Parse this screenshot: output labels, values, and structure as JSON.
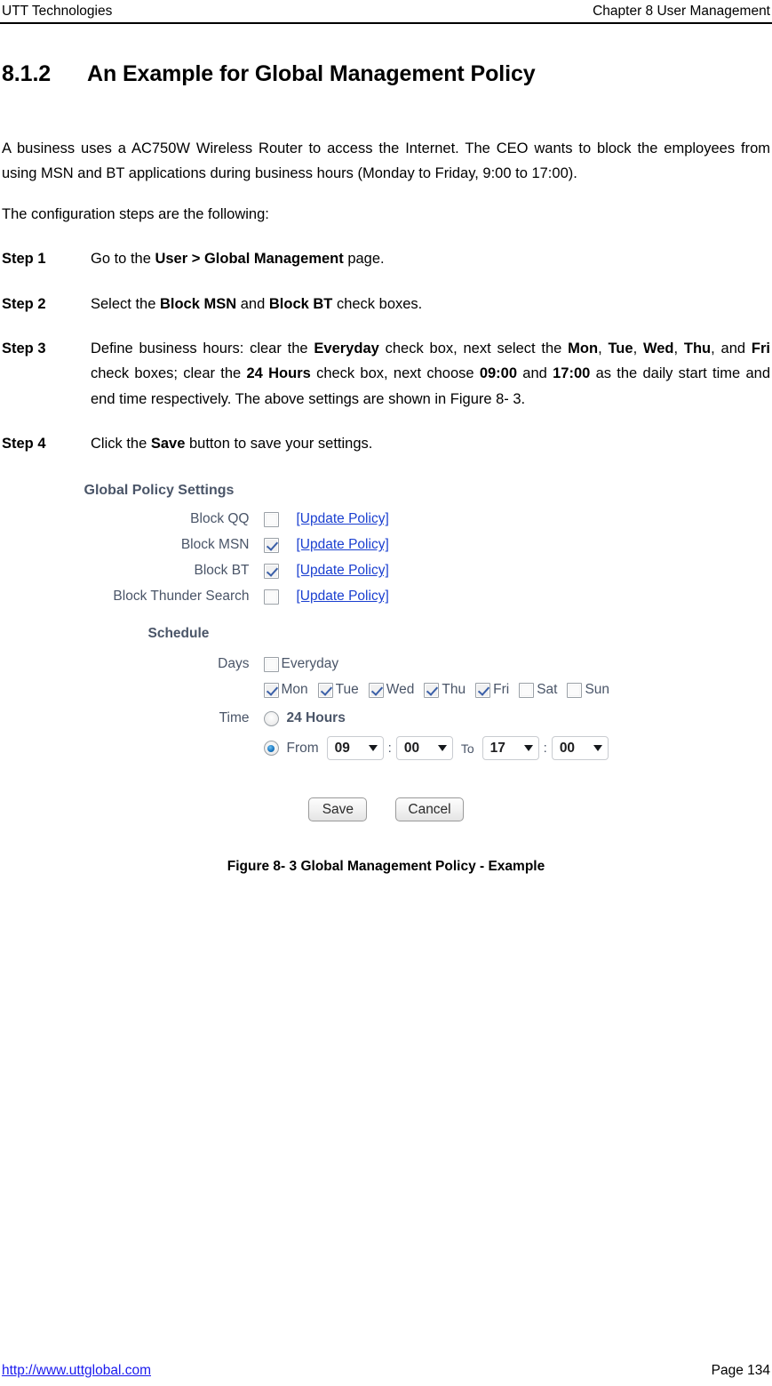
{
  "header": {
    "left": "UTT Technologies",
    "right": "Chapter 8 User Management"
  },
  "section": {
    "number": "8.1.2",
    "title": "An Example for Global Management Policy"
  },
  "intro": {
    "paragraph": "A business uses a AC750W Wireless Router to access the Internet. The CEO wants to block the employees from using MSN and BT applications during business hours (Monday to Friday, 9:00 to 17:00).",
    "steps_lead": "The configuration steps are the following:"
  },
  "steps": [
    {
      "label": "Step 1",
      "parts": [
        {
          "text": "Go to the ",
          "bold": false
        },
        {
          "text": "User > Global Management",
          "bold": true
        },
        {
          "text": " page.",
          "bold": false
        }
      ]
    },
    {
      "label": "Step 2",
      "parts": [
        {
          "text": "Select the ",
          "bold": false
        },
        {
          "text": "Block MSN",
          "bold": true
        },
        {
          "text": " and ",
          "bold": false
        },
        {
          "text": "Block BT",
          "bold": true
        },
        {
          "text": " check boxes.",
          "bold": false
        }
      ]
    },
    {
      "label": "Step 3",
      "parts": [
        {
          "text": "Define business hours: clear the ",
          "bold": false
        },
        {
          "text": "Everyday",
          "bold": true
        },
        {
          "text": " check box, next select the ",
          "bold": false
        },
        {
          "text": "Mon",
          "bold": true
        },
        {
          "text": ", ",
          "bold": false
        },
        {
          "text": "Tue",
          "bold": true
        },
        {
          "text": ", ",
          "bold": false
        },
        {
          "text": "Wed",
          "bold": true
        },
        {
          "text": ", ",
          "bold": false
        },
        {
          "text": "Thu",
          "bold": true
        },
        {
          "text": ", and ",
          "bold": false
        },
        {
          "text": "Fri",
          "bold": true
        },
        {
          "text": " check boxes; clear the ",
          "bold": false
        },
        {
          "text": "24 Hours",
          "bold": true
        },
        {
          "text": " check box, next choose ",
          "bold": false
        },
        {
          "text": "09:00",
          "bold": true
        },
        {
          "text": " and ",
          "bold": false
        },
        {
          "text": "17:00",
          "bold": true
        },
        {
          "text": " as the daily start time and end time respectively. The above settings are shown in Figure 8- 3.",
          "bold": false
        }
      ]
    },
    {
      "label": "Step 4",
      "parts": [
        {
          "text": "Click the ",
          "bold": false
        },
        {
          "text": "Save",
          "bold": true
        },
        {
          "text": " button to save your settings.",
          "bold": false
        }
      ]
    }
  ],
  "router_ui": {
    "global_policy_title": "Global Policy Settings",
    "policies": [
      {
        "label": "Block QQ",
        "checked": false,
        "link": "[Update Policy]"
      },
      {
        "label": "Block MSN",
        "checked": true,
        "link": "[Update Policy]"
      },
      {
        "label": "Block BT",
        "checked": true,
        "link": "[Update Policy]"
      },
      {
        "label": "Block Thunder Search",
        "checked": false,
        "link": "[Update Policy]"
      }
    ],
    "schedule_title": "Schedule",
    "days_label": "Days",
    "everyday": {
      "label": "Everyday",
      "checked": false
    },
    "weekdays": [
      {
        "label": "Mon",
        "checked": true
      },
      {
        "label": "Tue",
        "checked": true
      },
      {
        "label": "Wed",
        "checked": true
      },
      {
        "label": "Thu",
        "checked": true
      },
      {
        "label": "Fri",
        "checked": true
      },
      {
        "label": "Sat",
        "checked": false
      },
      {
        "label": "Sun",
        "checked": false
      }
    ],
    "time_label": "Time",
    "time_mode_24h": {
      "label": "24 Hours",
      "selected": false
    },
    "time_mode_range": {
      "label": "From",
      "selected": true
    },
    "to_label": "To",
    "colon": ":",
    "from_hour": "09",
    "from_minute": "00",
    "to_hour": "17",
    "to_minute": "00",
    "save_label": "Save",
    "cancel_label": "Cancel",
    "accent_link_color": "#1a3fd0",
    "check_color": "#3a5fa8",
    "radio_color": "#1b79c4"
  },
  "figure_caption": "Figure 8- 3 Global Management Policy - Example",
  "footer": {
    "url": "http://www.uttglobal.com",
    "page": "Page 134"
  }
}
